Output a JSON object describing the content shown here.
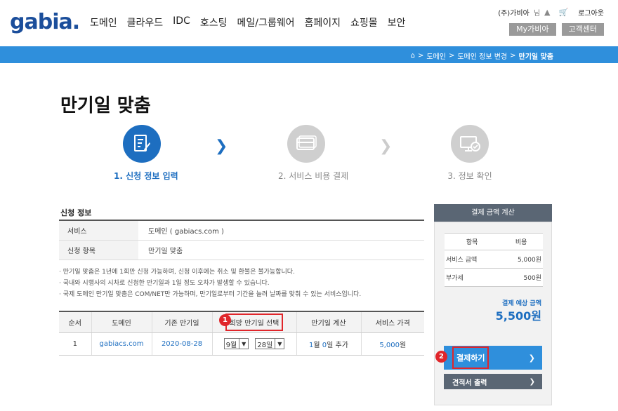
{
  "header": {
    "logo": "gabia.",
    "nav": [
      "도메인",
      "클라우드",
      "IDC",
      "호스팅",
      "메일/그룹웨어",
      "홈페이지",
      "쇼핑몰",
      "보안"
    ],
    "user": "(주)가비아",
    "user_suffix": "님",
    "logout": "로그아웃",
    "my_gabia": "My가비아",
    "support": "고객센터"
  },
  "breadcrumb": {
    "items": [
      "도메인",
      "도메인 정보 변경"
    ],
    "current": "만기일 맞춤",
    "sep": ">"
  },
  "page_title": "만기일 맞춤",
  "steps": [
    {
      "label": "1. 신청 정보 입력",
      "icon": "form-edit-icon",
      "state": "active"
    },
    {
      "label": "2. 서비스 비용 결제",
      "icon": "credit-card-icon",
      "state": "inactive"
    },
    {
      "label": "3. 정보 확인",
      "icon": "monitor-check-icon",
      "state": "inactive"
    }
  ],
  "apply_info": {
    "title": "신청 정보",
    "rows": [
      {
        "label": "서비스",
        "value": "도메인 ( gabiacs.com )"
      },
      {
        "label": "신청 항목",
        "value": "만기일 맞춤"
      }
    ]
  },
  "notes": [
    "만기일 맞춤은 1년에 1회만 신청 가능하며, 신청 이후에는 취소 및 환불은 불가능합니다.",
    "국내와 시행사의 시차로 신청한 만기일과 1일 정도 오차가 발생할 수 있습니다.",
    "국제 도메인 만기일 맞춤은 COM/NET만 가능하며, 만기일로부터 기간을 늘려 날짜를 맞춰 수 있는 서비스입니다."
  ],
  "domain_table": {
    "headers": [
      "순서",
      "도메인",
      "기존 만기일",
      "희망 만기일 선택",
      "만기일 계산",
      "서비스 가격"
    ],
    "row": {
      "index": "1",
      "domain": "gabiacs.com",
      "expiry": "2020-08-28",
      "month": "9월",
      "day": "28일",
      "calc_pre": "1",
      "calc_mid": "월 ",
      "calc_num": "0",
      "calc_post": "일 추가",
      "price_num": "5,000",
      "price_unit": "원"
    }
  },
  "side": {
    "title": "결제 금액 계산",
    "headers": [
      "항목",
      "비용"
    ],
    "rows": [
      {
        "label": "서비스 금액",
        "value": "5,000원"
      },
      {
        "label": "부가세",
        "value": "500원"
      }
    ],
    "total_label": "결제 예상 금액",
    "total_value": "5,500원",
    "pay": "결제하기",
    "estimate": "견적서 출력"
  },
  "annotations": {
    "badge1": "1",
    "badge2": "2"
  },
  "colors": {
    "brand_blue": "#2f8fdc",
    "active_step": "#1d6ec0",
    "highlight": "#e0262b",
    "panel_dark": "#5a6674"
  }
}
